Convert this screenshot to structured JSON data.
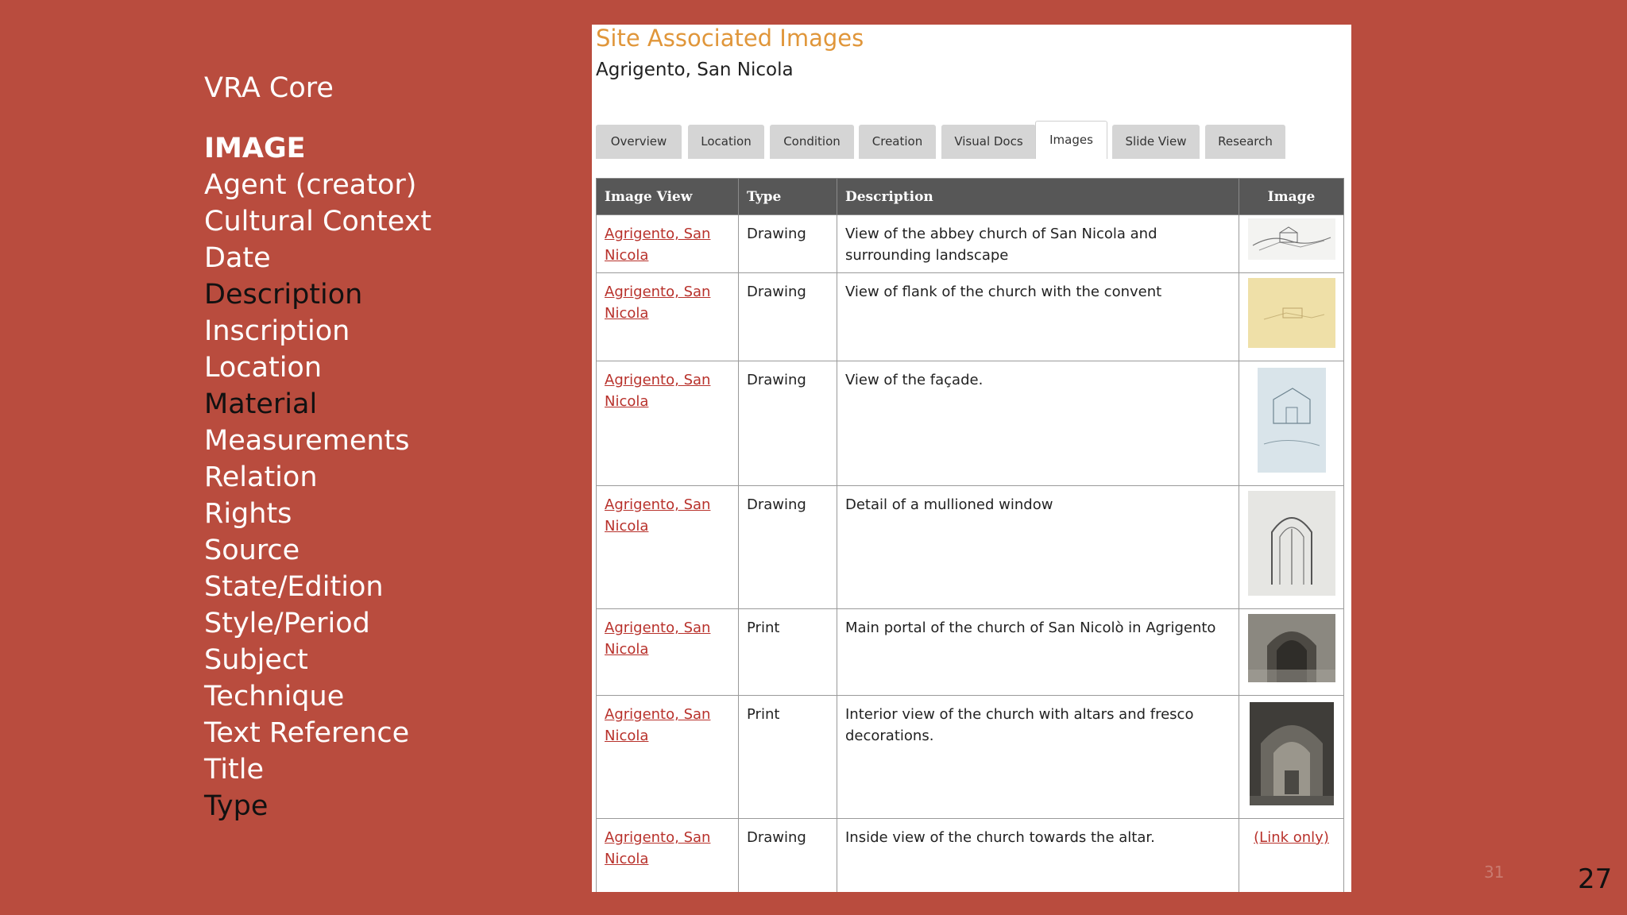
{
  "slide": {
    "vra_heading": "VRA Core",
    "items": [
      {
        "label": "IMAGE",
        "style": "heading"
      },
      {
        "label": "Agent (creator)",
        "style": "white"
      },
      {
        "label": "Cultural Context",
        "style": "white"
      },
      {
        "label": "Date",
        "style": "white"
      },
      {
        "label": "Description",
        "style": "dark"
      },
      {
        "label": "Inscription",
        "style": "white"
      },
      {
        "label": "Location",
        "style": "white"
      },
      {
        "label": "Material",
        "style": "dark"
      },
      {
        "label": "Measurements",
        "style": "white"
      },
      {
        "label": "Relation",
        "style": "white"
      },
      {
        "label": "Rights",
        "style": "white"
      },
      {
        "label": "Source",
        "style": "white"
      },
      {
        "label": "State/Edition",
        "style": "white"
      },
      {
        "label": "Style/Period",
        "style": "white"
      },
      {
        "label": "Subject",
        "style": "white"
      },
      {
        "label": "Technique",
        "style": "white"
      },
      {
        "label": "Text Reference",
        "style": "white"
      },
      {
        "label": "Title",
        "style": "white"
      },
      {
        "label": "Type",
        "style": "dark"
      }
    ],
    "page_small": "31",
    "page_number": "27"
  },
  "panel": {
    "title": "Site Associated Images",
    "subtitle": "Agrigento, San Nicola",
    "tabs": [
      {
        "label": "Overview",
        "active": false
      },
      {
        "label": "Location",
        "active": false
      },
      {
        "label": "Condition",
        "active": false
      },
      {
        "label": "Creation",
        "active": false
      },
      {
        "label": "Visual Docs",
        "active": false
      },
      {
        "label": "Images",
        "active": true
      },
      {
        "label": "Slide View",
        "active": false
      },
      {
        "label": "Research",
        "active": false
      }
    ],
    "table": {
      "headers": [
        "Image View",
        "Type",
        "Description",
        "Image"
      ],
      "rows": [
        {
          "view": "Agrigento, San Nicola",
          "type": "Drawing",
          "description": "View of the abbey church of San Nicola and surrounding landscape",
          "image": "sketch-landscape-thumbnail"
        },
        {
          "view": "Agrigento, San Nicola",
          "type": "Drawing",
          "description": "View of flank of the church with the convent",
          "image": "yellowed-drawing-thumbnail"
        },
        {
          "view": "Agrigento, San Nicola",
          "type": "Drawing",
          "description": "View of the façade.",
          "image": "blue-sketch-thumbnail"
        },
        {
          "view": "Agrigento, San Nicola",
          "type": "Drawing",
          "description": "Detail of a mullioned window",
          "image": "window-drawing-thumbnail"
        },
        {
          "view": "Agrigento, San Nicola",
          "type": "Print",
          "description": "Main portal of the church of San Nicolò in Agrigento",
          "image": "portal-print-thumbnail"
        },
        {
          "view": "Agrigento, San Nicola",
          "type": "Print",
          "description": "Interior view of the church with altars and fresco decorations.",
          "image": "interior-print-thumbnail"
        },
        {
          "view": "Agrigento, San Nicola",
          "type": "Drawing",
          "description": "Inside view of the church towards the altar.",
          "image": "(Link only)"
        }
      ]
    }
  }
}
